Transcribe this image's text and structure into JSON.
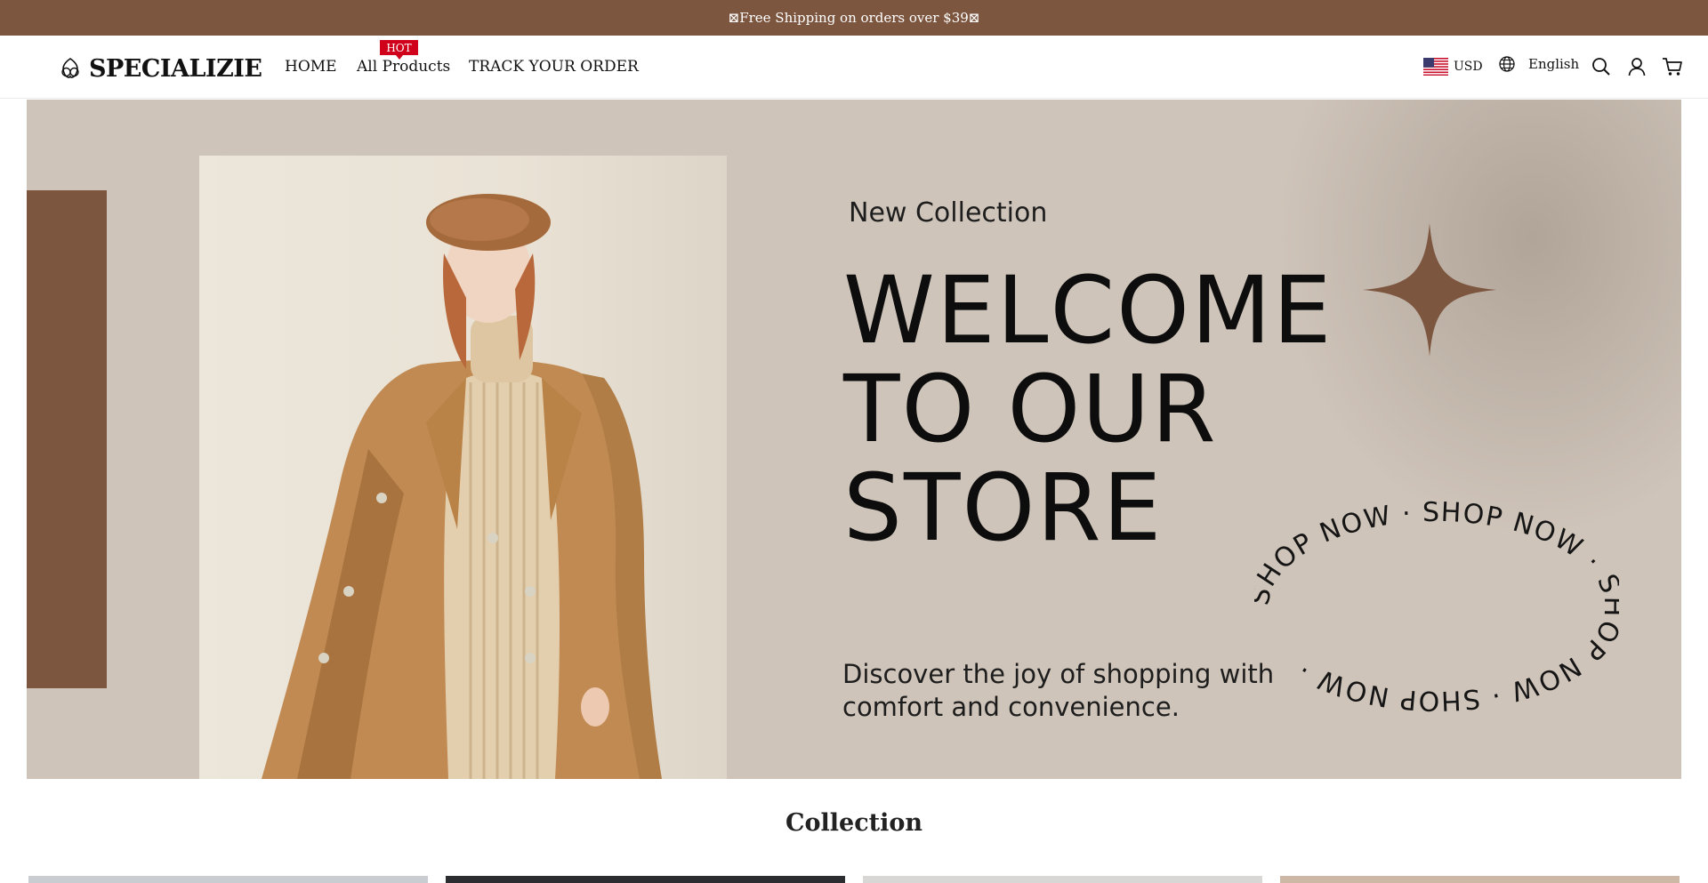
{
  "announcement": {
    "text": "⊠Free Shipping on orders over $39⊠"
  },
  "header": {
    "brand": "SPECIALIZIE",
    "nav": [
      {
        "label": "HOME"
      },
      {
        "label": "All Products",
        "badge": "HOT"
      },
      {
        "label": "TRACK YOUR ORDER"
      }
    ],
    "currency": "USD",
    "language": "English",
    "icons": [
      "globe-icon",
      "search-icon",
      "account-icon",
      "cart-icon"
    ]
  },
  "hero": {
    "eyebrow": "New Collection",
    "title_lines": [
      "WELCOME",
      "TO OUR",
      "STORE"
    ],
    "ring_text": "SHOP NOW · SHOP NOW · SHOP NOW · SHOP NOW · ",
    "description_lines": [
      "Discover the joy of shopping with",
      "comfort and convenience."
    ]
  },
  "collection": {
    "title": "Collection",
    "cards": [
      {
        "tone": "#c9ccd0"
      },
      {
        "tone": "#2b2d30"
      },
      {
        "tone": "#d8d7d5"
      },
      {
        "tone": "#cdb8a6"
      }
    ]
  },
  "colors": {
    "accent_brown": "#7d5640",
    "hero_background": "#cfc4b9",
    "badge_red": "#d0021b"
  }
}
